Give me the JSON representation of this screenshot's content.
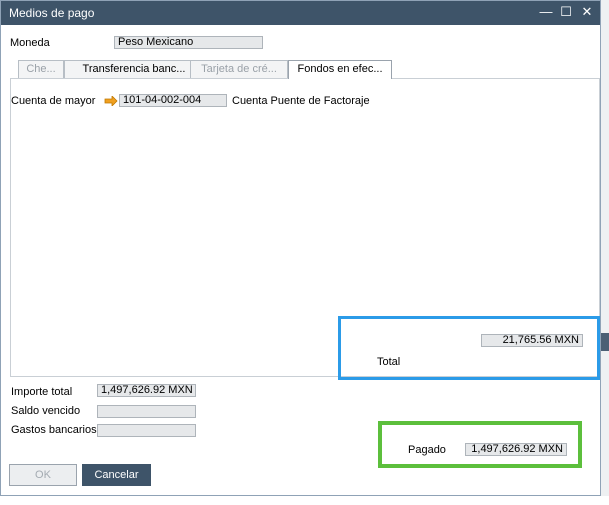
{
  "window": {
    "title": "Medios de pago",
    "minimize_glyph": "—",
    "maximize_glyph": "☐",
    "close_glyph": "✕"
  },
  "header": {
    "currency_label": "Moneda",
    "currency_value": "Peso Mexicano"
  },
  "tabs": [
    {
      "label": "Che..."
    },
    {
      "label": "Transferencia banc..."
    },
    {
      "label": "Tarjeta de cré..."
    },
    {
      "label": "Fondos en efec..."
    }
  ],
  "cash_tab": {
    "account_label": "Cuenta de mayor",
    "account_value": "101-04-002-004",
    "account_name": "Cuenta Puente de Factoraje",
    "total_value": "21,765.56 MXN",
    "total_label": "Total"
  },
  "summary": {
    "total_amount_label": "Importe total",
    "total_amount_value": "1,497,626.92 MXN",
    "overdue_label": "Saldo vencido",
    "overdue_value": "",
    "bank_charges_label": "Gastos bancarios",
    "bank_charges_value": "",
    "paid_label": "Pagado",
    "paid_value": "1,497,626.92 MXN"
  },
  "buttons": {
    "ok": "OK",
    "cancel": "Cancelar"
  },
  "colors": {
    "titlebar": "#3e5469",
    "highlight_blue": "#2b9be8",
    "highlight_green": "#5cbf3c",
    "arrow": "#f0a020"
  }
}
